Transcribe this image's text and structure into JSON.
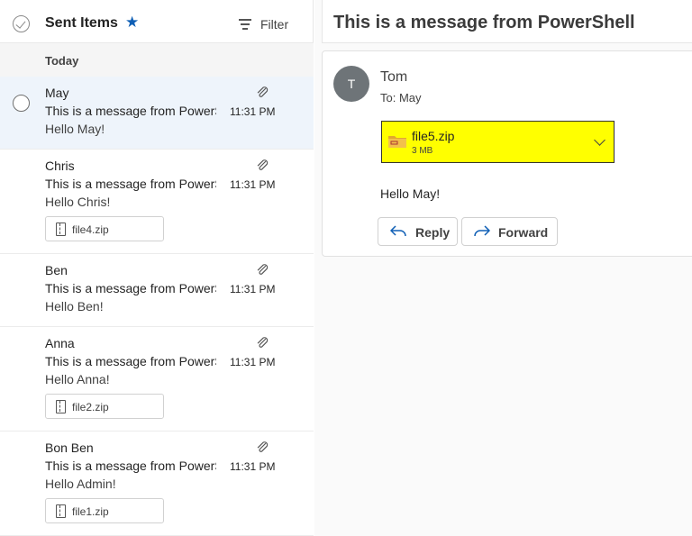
{
  "folder": {
    "title": "Sent Items",
    "filter_label": "Filter",
    "icons": {
      "select_all": "check-circle-icon",
      "favorite": "star-filled-icon",
      "filter": "filter-lines-icon"
    }
  },
  "group_label": "Today",
  "messages": [
    {
      "sender": "May",
      "subject": "This is a message from PowerShell",
      "preview": "Hello May!",
      "time": "11:31 PM",
      "attachment": ""
    },
    {
      "sender": "Chris",
      "subject": "This is a message from PowerShell",
      "preview": "Hello Chris!",
      "time": "11:31 PM",
      "attachment": "file4.zip"
    },
    {
      "sender": "Ben",
      "subject": "This is a message from PowerShell",
      "preview": "Hello Ben!",
      "time": "11:31 PM",
      "attachment": ""
    },
    {
      "sender": "Anna",
      "subject": "This is a message from PowerShell",
      "preview": "Hello Anna!",
      "time": "11:31 PM",
      "attachment": "file2.zip"
    },
    {
      "sender": "Bon Ben",
      "subject": "This is a message from PowerShell",
      "preview": "Hello Admin!",
      "time": "11:31 PM",
      "attachment": "file1.zip"
    }
  ],
  "reading": {
    "subject": "This is a message from PowerShell",
    "avatar_initial": "T",
    "from": "Tom",
    "to": "To:  May",
    "attachment": {
      "name": "file5.zip",
      "size": "3 MB",
      "highlight_color": "#ffff00"
    },
    "body": "Hello May!",
    "reply_label": "Reply",
    "forward_label": "Forward"
  },
  "colors": {
    "accent": "#0f5fb5",
    "selected_row": "#eef4fb"
  }
}
